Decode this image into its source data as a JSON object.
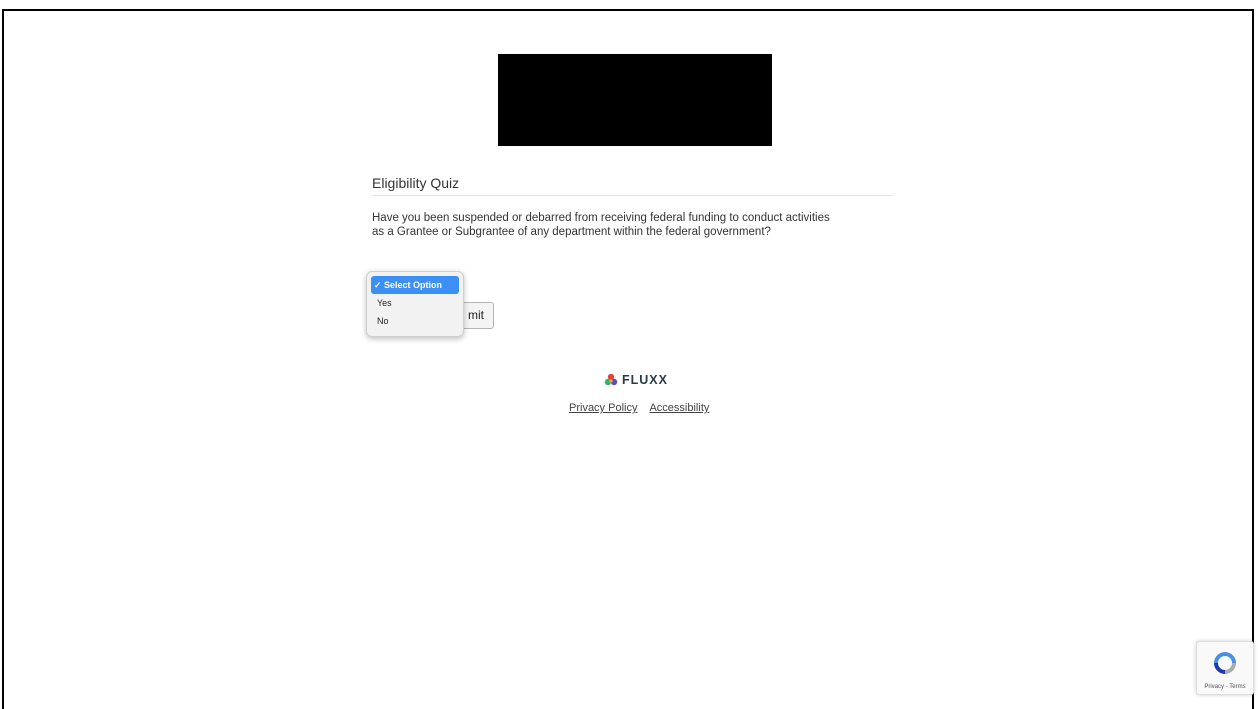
{
  "quiz": {
    "title": "Eligibility Quiz",
    "question": "Have you been suspended or debarred from receiving federal funding to conduct activities as a Grantee or Subgrantee of any department within the federal government?",
    "select": {
      "options": [
        "Select Option",
        "Yes",
        "No"
      ],
      "selected": "Select Option",
      "check_glyph": "✓"
    },
    "submit_label": "mit",
    "submit_full_label": "Submit"
  },
  "brand": {
    "name": "FLUXX",
    "icon": "fluxx-logo-icon",
    "colors": [
      "#e8413b",
      "#2fb36b",
      "#5b4fb5",
      "#f2a93b"
    ]
  },
  "footer": {
    "links": [
      "Privacy Policy",
      "Accessibility"
    ]
  },
  "recaptcha": {
    "text": "Privacy - Terms",
    "icon": "recaptcha-icon"
  },
  "colors": {
    "select_highlight": "#3b8ff5",
    "redacted_logo": "#000000"
  }
}
